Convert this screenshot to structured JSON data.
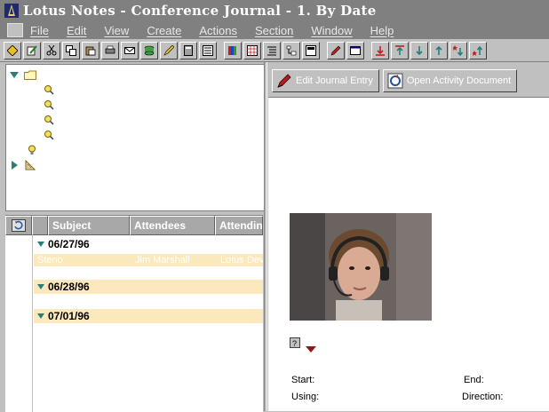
{
  "window": {
    "title": "Lotus Notes - Conference Journal - 1. By Date",
    "icon": "lotus-notes-app-icon"
  },
  "menu": {
    "items": [
      "File",
      "Edit",
      "View",
      "Create",
      "Actions",
      "Section",
      "Window",
      "Help"
    ]
  },
  "toolbar": {
    "icons": [
      "smarticon-diamond-icon",
      "edit-document-icon",
      "cut-icon",
      "copy-icon",
      "paste-icon",
      "printer-icon",
      "mail-icon",
      "database-icon",
      "edit-mode-icon",
      "calculator-icon",
      "properties-icon",
      "bookshelf-icon",
      "spreadsheet-icon",
      "outline-icon",
      "tree-icon",
      "view-icon",
      "pen-edit-icon",
      "window-icon",
      "navigate-down-red-icon",
      "navigate-up-icon",
      "navigate-down-icon",
      "navigate-up-green-icon",
      "next-unread-icon",
      "prev-unread-icon"
    ]
  },
  "navigator": {
    "items": [
      {
        "icon": "folder-icon",
        "expanded": true
      },
      {
        "icon": "search-view-icon"
      },
      {
        "icon": "search-view-icon"
      },
      {
        "icon": "search-view-icon"
      },
      {
        "icon": "search-view-icon"
      },
      {
        "icon": "agent-bulb-icon"
      },
      {
        "icon": "design-icon",
        "expanded": false
      }
    ]
  },
  "view": {
    "columns": [
      "Subject",
      "Attendees",
      "Attending"
    ],
    "groups": [
      {
        "date": "06/27/96",
        "expanded": true,
        "rows": [
          {
            "subject": "Steno",
            "attendees": "Jim Marshall",
            "attending": "Lotus Dev"
          }
        ]
      },
      {
        "date": "06/28/96",
        "expanded": true,
        "rows": []
      },
      {
        "date": "07/01/96",
        "expanded": true,
        "rows": []
      }
    ]
  },
  "document": {
    "actions": [
      {
        "label": "Edit Journal Entry",
        "icon": "pen-edit-icon"
      },
      {
        "label": "Open Activity Document",
        "icon": "open-activity-icon"
      }
    ],
    "fields": {
      "start": "Start:",
      "end": "End:",
      "using": "Using:",
      "direction": "Direction:"
    }
  },
  "colors": {
    "title_bg": "#808080",
    "selection_bg": "#fbe9bd",
    "twistie": "#2a7d7a"
  }
}
